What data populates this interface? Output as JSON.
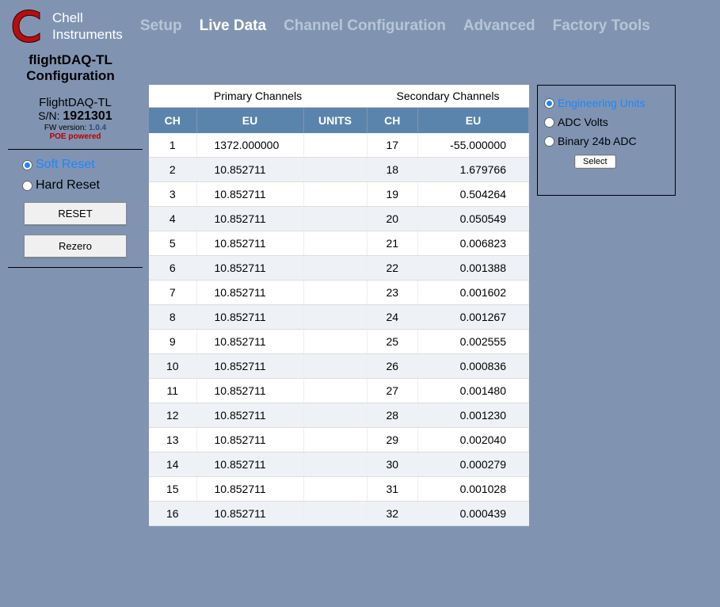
{
  "brand": {
    "line1": "Chell",
    "line2": "Instruments"
  },
  "nav": {
    "setup": "Setup",
    "live_data": "Live Data",
    "channel_config": "Channel Configuration",
    "advanced": "Advanced",
    "factory": "Factory Tools"
  },
  "subtitle": {
    "line1": "flightDAQ-TL",
    "line2": "Configuration"
  },
  "device": {
    "name": "FlightDAQ-TL",
    "sn_label": "S/N:",
    "sn_value": "1921301",
    "fw_label": "FW version:",
    "fw_value": "1.0.4",
    "poe": "POE powered"
  },
  "reset": {
    "soft": "Soft Reset",
    "hard": "Hard Reset",
    "reset_btn": "RESET",
    "rezero_btn": "Rezero"
  },
  "table": {
    "primary_title": "Primary Channels",
    "secondary_title": "Secondary Channels",
    "col_ch": "CH",
    "col_eu": "EU",
    "col_units": "UNITS",
    "primary": [
      {
        "ch": "1",
        "eu": "1372.000000"
      },
      {
        "ch": "2",
        "eu": "10.852711"
      },
      {
        "ch": "3",
        "eu": "10.852711"
      },
      {
        "ch": "4",
        "eu": "10.852711"
      },
      {
        "ch": "5",
        "eu": "10.852711"
      },
      {
        "ch": "6",
        "eu": "10.852711"
      },
      {
        "ch": "7",
        "eu": "10.852711"
      },
      {
        "ch": "8",
        "eu": "10.852711"
      },
      {
        "ch": "9",
        "eu": "10.852711"
      },
      {
        "ch": "10",
        "eu": "10.852711"
      },
      {
        "ch": "11",
        "eu": "10.852711"
      },
      {
        "ch": "12",
        "eu": "10.852711"
      },
      {
        "ch": "13",
        "eu": "10.852711"
      },
      {
        "ch": "14",
        "eu": "10.852711"
      },
      {
        "ch": "15",
        "eu": "10.852711"
      },
      {
        "ch": "16",
        "eu": "10.852711"
      }
    ],
    "secondary": [
      {
        "ch": "17",
        "eu": "-55.000000"
      },
      {
        "ch": "18",
        "eu": "1.679766"
      },
      {
        "ch": "19",
        "eu": "0.504264"
      },
      {
        "ch": "20",
        "eu": "0.050549"
      },
      {
        "ch": "21",
        "eu": "0.006823"
      },
      {
        "ch": "22",
        "eu": "0.001388"
      },
      {
        "ch": "23",
        "eu": "0.001602"
      },
      {
        "ch": "24",
        "eu": "0.001267"
      },
      {
        "ch": "25",
        "eu": "0.002555"
      },
      {
        "ch": "26",
        "eu": "0.000836"
      },
      {
        "ch": "27",
        "eu": "0.001480"
      },
      {
        "ch": "28",
        "eu": "0.001230"
      },
      {
        "ch": "29",
        "eu": "0.002040"
      },
      {
        "ch": "30",
        "eu": "0.000279"
      },
      {
        "ch": "31",
        "eu": "0.001028"
      },
      {
        "ch": "32",
        "eu": "0.000439"
      }
    ]
  },
  "options": {
    "eu": "Engineering Units",
    "adc": "ADC Volts",
    "bin": "Binary 24b ADC",
    "select": "Select"
  }
}
